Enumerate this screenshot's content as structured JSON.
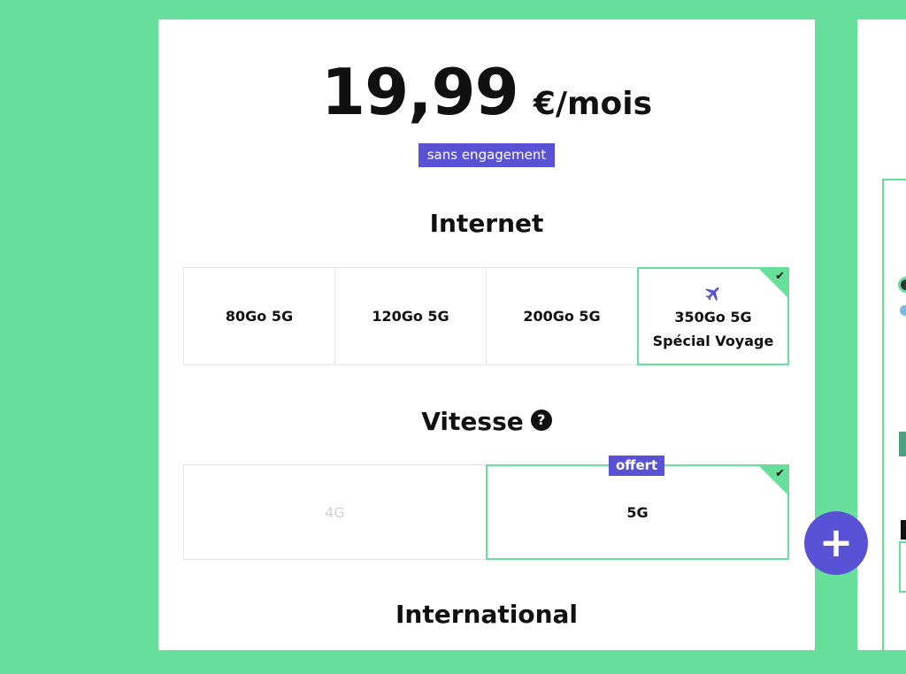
{
  "price": {
    "amount": "19,99",
    "unit": "€/mois"
  },
  "badge": "sans engagement",
  "internet": {
    "title": "Internet",
    "options": [
      {
        "label": "80Go 5G"
      },
      {
        "label": "120Go 5G"
      },
      {
        "label": "200Go 5G"
      },
      {
        "label": "350Go 5G",
        "sublabel": "Spécial Voyage",
        "icon": "airplane-icon",
        "selected": true
      }
    ]
  },
  "speed": {
    "title": "Vitesse",
    "help_icon": "?",
    "options": [
      {
        "label": "4G",
        "disabled": true
      },
      {
        "label": "5G",
        "tag": "offert",
        "selected": true
      }
    ]
  },
  "international": {
    "title": "International"
  },
  "fab_icon": "plus-icon",
  "fab_label": "+",
  "check_glyph": "✔",
  "colors": {
    "background": "#66df9b",
    "accent": "#5a52d5",
    "selected_border": "#66df9b"
  }
}
